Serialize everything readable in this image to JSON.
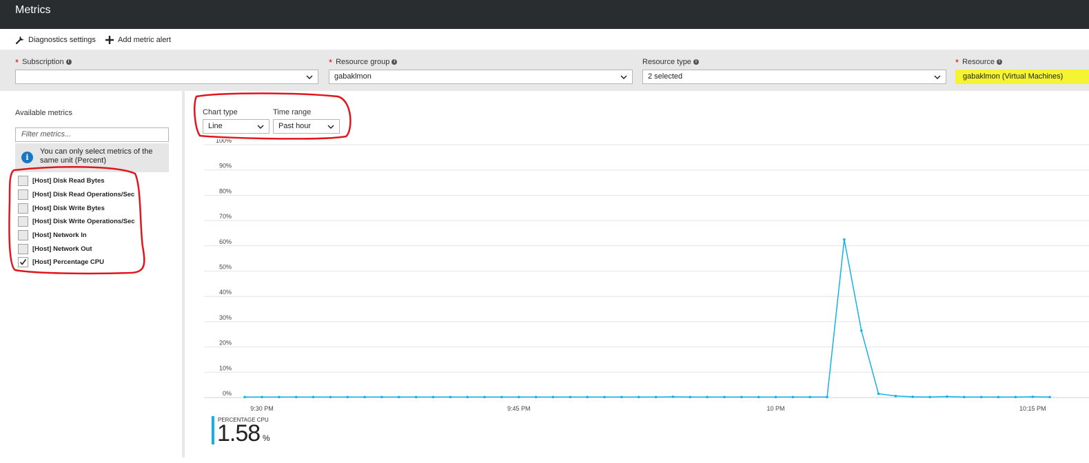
{
  "header": {
    "title": "Metrics"
  },
  "toolbar": {
    "diagnostics_label": "Diagnostics settings",
    "add_alert_label": "Add metric alert"
  },
  "filters": {
    "subscription": {
      "label": "Subscription",
      "value": ""
    },
    "resource_group": {
      "label": "Resource group",
      "value": "gabaklmon"
    },
    "resource_type": {
      "label": "Resource type",
      "value": "2 selected"
    },
    "resource": {
      "label": "Resource",
      "value": "gabaklmon (Virtual Machines)"
    }
  },
  "sidebar": {
    "available_metrics_label": "Available metrics",
    "filter_placeholder": "Filter metrics...",
    "notice": "You can only select metrics of the same unit (Percent)",
    "metrics": [
      {
        "label": "[Host] Disk Read Bytes",
        "checked": false
      },
      {
        "label": "[Host] Disk Read Operations/Sec",
        "checked": false
      },
      {
        "label": "[Host] Disk Write Bytes",
        "checked": false
      },
      {
        "label": "[Host] Disk Write Operations/Sec",
        "checked": false
      },
      {
        "label": "[Host] Network In",
        "checked": false
      },
      {
        "label": "[Host] Network Out",
        "checked": false
      },
      {
        "label": "[Host] Percentage CPU",
        "checked": true
      }
    ]
  },
  "controls": {
    "chart_type_label": "Chart type",
    "chart_type_value": "Line",
    "time_range_label": "Time range",
    "time_range_value": "Past hour"
  },
  "chart_data": {
    "type": "line",
    "title": "",
    "xlabel": "",
    "ylabel": "",
    "x_tick_labels": [
      "9:30 PM",
      "9:45 PM",
      "10 PM",
      "10:15 PM"
    ],
    "x_tick_minutes": [
      0,
      15,
      30,
      45
    ],
    "ylim": [
      0,
      100
    ],
    "y_tick_labels": [
      "0%",
      "10%",
      "20%",
      "30%",
      "40%",
      "50%",
      "60%",
      "70%",
      "80%",
      "90%",
      "100%"
    ],
    "grid": true,
    "series": [
      {
        "name": "PERCENTAGE CPU",
        "color": "#12b2e8",
        "x_minutes": [
          -1,
          0,
          1,
          2,
          3,
          4,
          5,
          6,
          7,
          8,
          9,
          10,
          11,
          12,
          13,
          14,
          15,
          16,
          17,
          18,
          19,
          20,
          21,
          22,
          23,
          24,
          25,
          26,
          27,
          28,
          29,
          30,
          31,
          32,
          33,
          34,
          35,
          36,
          37,
          38,
          39,
          40,
          41,
          42,
          43,
          44,
          45,
          46
        ],
        "values": [
          0.2,
          0.2,
          0.2,
          0.2,
          0.2,
          0.2,
          0.2,
          0.2,
          0.2,
          0.2,
          0.2,
          0.2,
          0.2,
          0.2,
          0.2,
          0.2,
          0.2,
          0.2,
          0.2,
          0.2,
          0.2,
          0.2,
          0.2,
          0.2,
          0.2,
          0.3,
          0.2,
          0.2,
          0.2,
          0.2,
          0.2,
          0.2,
          0.2,
          0.2,
          0.2,
          62.5,
          26.5,
          1.5,
          0.6,
          0.3,
          0.2,
          0.4,
          0.2,
          0.2,
          0.2,
          0.2,
          0.3,
          0.2
        ]
      }
    ]
  },
  "legend": {
    "name": "PERCENTAGE CPU",
    "value": "1.58",
    "unit": "%"
  },
  "colors": {
    "titlebar": "#2a2d30",
    "accent": "#12b2e8",
    "highlight": "#f4f432",
    "annotation": "#e0161c"
  }
}
